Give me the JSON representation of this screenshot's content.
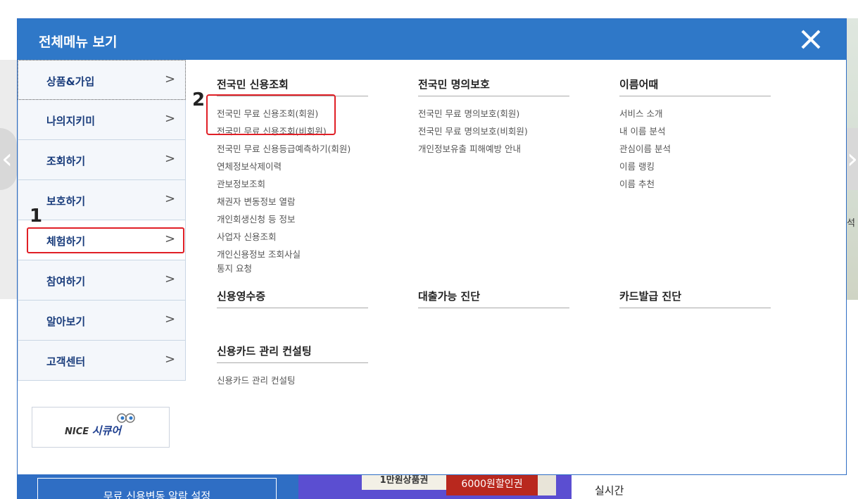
{
  "background": {
    "right_char": "석",
    "bottom_button": "무료 신용변동 알람 설정",
    "coupon_1": "1만원상품권",
    "coupon_2": "6000원할인권",
    "realtime": "실시간"
  },
  "modal": {
    "title": "전체메뉴 보기",
    "close_icon": "close-icon"
  },
  "left_menu": {
    "items": [
      {
        "label": "상품&가입",
        "chevron": ">"
      },
      {
        "label": "나의지키미",
        "chevron": ">"
      },
      {
        "label": "조회하기",
        "chevron": ">"
      },
      {
        "label": "보호하기",
        "chevron": ">"
      },
      {
        "label": "체험하기",
        "chevron": ">"
      },
      {
        "label": "참여하기",
        "chevron": ">"
      },
      {
        "label": "알아보기",
        "chevron": ">"
      },
      {
        "label": "고객센터",
        "chevron": ">"
      }
    ],
    "active_index": 4
  },
  "annotations": {
    "num_1": "1",
    "num_2": "2",
    "highlight_color": "#e01f26"
  },
  "logo": {
    "brand": "NICE",
    "product": "시큐어"
  },
  "columns": {
    "c1": {
      "title": "전국민 신용조회",
      "links": [
        "전국민 무료 신용조회(회원)",
        "전국민 무료 신용조회(비회원)",
        "전국민 무료 신용등급예측하기(회원)",
        "연체정보삭제이력",
        "관보정보조회",
        "채권자 변동정보 열람",
        "개인회생신청 등 정보",
        "사업자 신용조회",
        "개인신용정보 조회사실",
        "통지 요청"
      ]
    },
    "c2": {
      "title": "전국민 명의보호",
      "links": [
        "전국민 무료 명의보호(회원)",
        "전국민 무료 명의보호(비회원)",
        "개인정보유출 피해예방 안내"
      ]
    },
    "c3": {
      "title": "이름어때",
      "links": [
        "서비스 소개",
        "내 이름 분석",
        "관심이름 분석",
        "이름 랭킹",
        "이름 추천"
      ]
    },
    "c4": {
      "title": "신용영수증"
    },
    "c5": {
      "title": "대출가능 진단"
    },
    "c6": {
      "title": "카드발급 진단"
    },
    "c7": {
      "title": "신용카드 관리 컨설팅",
      "links": [
        "신용카드 관리 컨설팅"
      ]
    }
  },
  "colors": {
    "header_blue": "#2f78c8",
    "menu_text": "#1a3d7c",
    "annotation_red": "#e01f26"
  }
}
